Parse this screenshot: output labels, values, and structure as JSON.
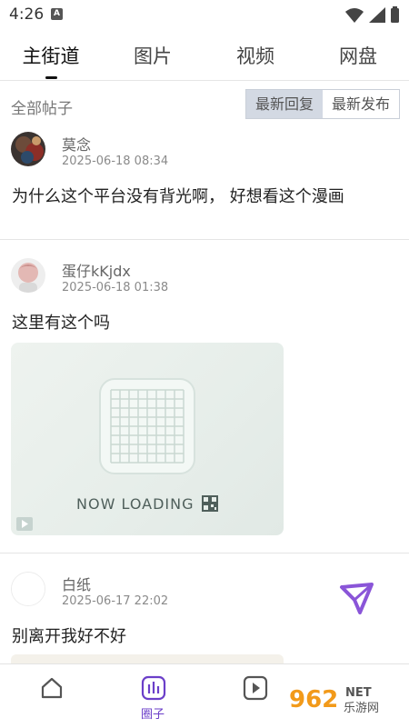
{
  "status_bar": {
    "time": "4:26",
    "indicator": "A"
  },
  "tabs": [
    {
      "label": "主街道",
      "active": true
    },
    {
      "label": "图片"
    },
    {
      "label": "视频"
    },
    {
      "label": "网盘"
    }
  ],
  "filter": {
    "label": "全部帖子",
    "options": [
      "最新回复",
      "最新发布"
    ],
    "selected": "最新回复"
  },
  "posts": [
    {
      "user": "莫念",
      "time": "2025-06-18 08:34",
      "text": "为什么这个平台没有背光啊， 好想看这个漫画"
    },
    {
      "user": "蛋仔kKjdx",
      "time": "2025-06-18 01:38",
      "text": "这里有这个吗",
      "image_text": "NOW LOADING"
    },
    {
      "user": "白纸",
      "time": "2025-06-17 22:02",
      "text": "别离开我好不好"
    }
  ],
  "bottom_nav": {
    "active_label": "圈子"
  },
  "watermark": {
    "text": "962",
    "sub": "乐游网",
    "net": "NET"
  },
  "colors": {
    "accent": "#6b3fc9",
    "segment_selected": "#d3d9e3"
  }
}
